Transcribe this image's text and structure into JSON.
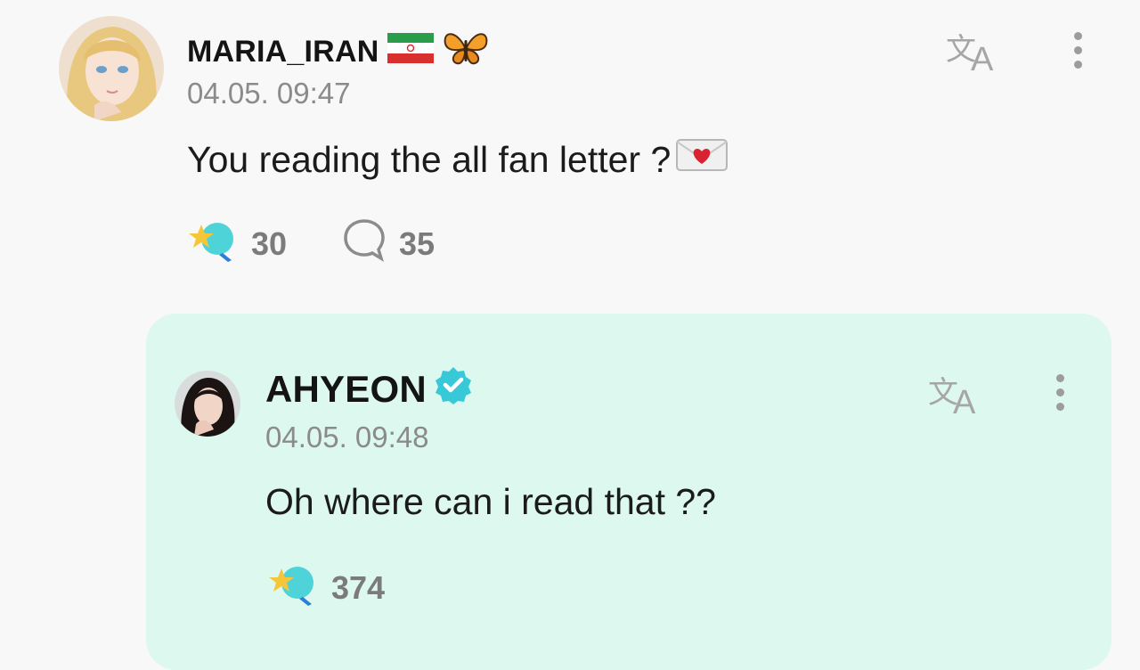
{
  "post": {
    "username": "MARIA_IRAN",
    "timestamp": "04.05. 09:47",
    "text": "You reading the all fan letter ?",
    "likes": "30",
    "comments": "35",
    "icons": [
      "iran-flag-emoji",
      "butterfly-emoji",
      "love-letter-emoji",
      "translate-icon",
      "more-vertical-icon",
      "star-bulb-reaction-icon",
      "comment-bubble-icon"
    ]
  },
  "reply": {
    "username": "AHYEON",
    "timestamp": "04.05. 09:48",
    "text": "Oh where can i read that ??",
    "likes": "374",
    "icons": [
      "verified-badge-icon",
      "translate-icon",
      "more-vertical-icon",
      "star-bulb-reaction-icon"
    ]
  },
  "colors": {
    "background": "#f7f8f7",
    "reply_card": "#dcf8ef",
    "accent_mint": "#40d6c8",
    "verified": "#37c9d8",
    "muted_text": "#8b8b8b"
  }
}
